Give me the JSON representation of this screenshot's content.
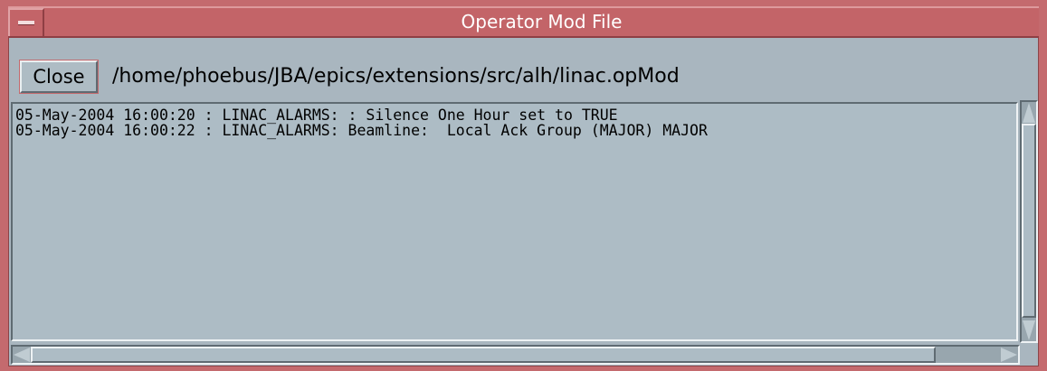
{
  "window": {
    "title": "Operator Mod File",
    "frame_color": "#c46a6e",
    "body_color": "#a9b6bf"
  },
  "toolbar": {
    "close_label": "Close",
    "file_path": "/home/phoebus/JBA/epics/extensions/src/alh/linac.opMod"
  },
  "log": {
    "lines": [
      "05-May-2004 16:00:20 : LINAC_ALARMS: : Silence One Hour set to TRUE",
      "05-May-2004 16:00:22 : LINAC_ALARMS: Beamline:  Local Ack Group (MAJOR) MAJOR"
    ]
  },
  "icons": {
    "window_menu": "window-menu-icon",
    "scroll_up": "scroll-up-arrow-icon",
    "scroll_down": "scroll-down-arrow-icon",
    "scroll_left": "scroll-left-arrow-icon",
    "scroll_right": "scroll-right-arrow-icon"
  }
}
